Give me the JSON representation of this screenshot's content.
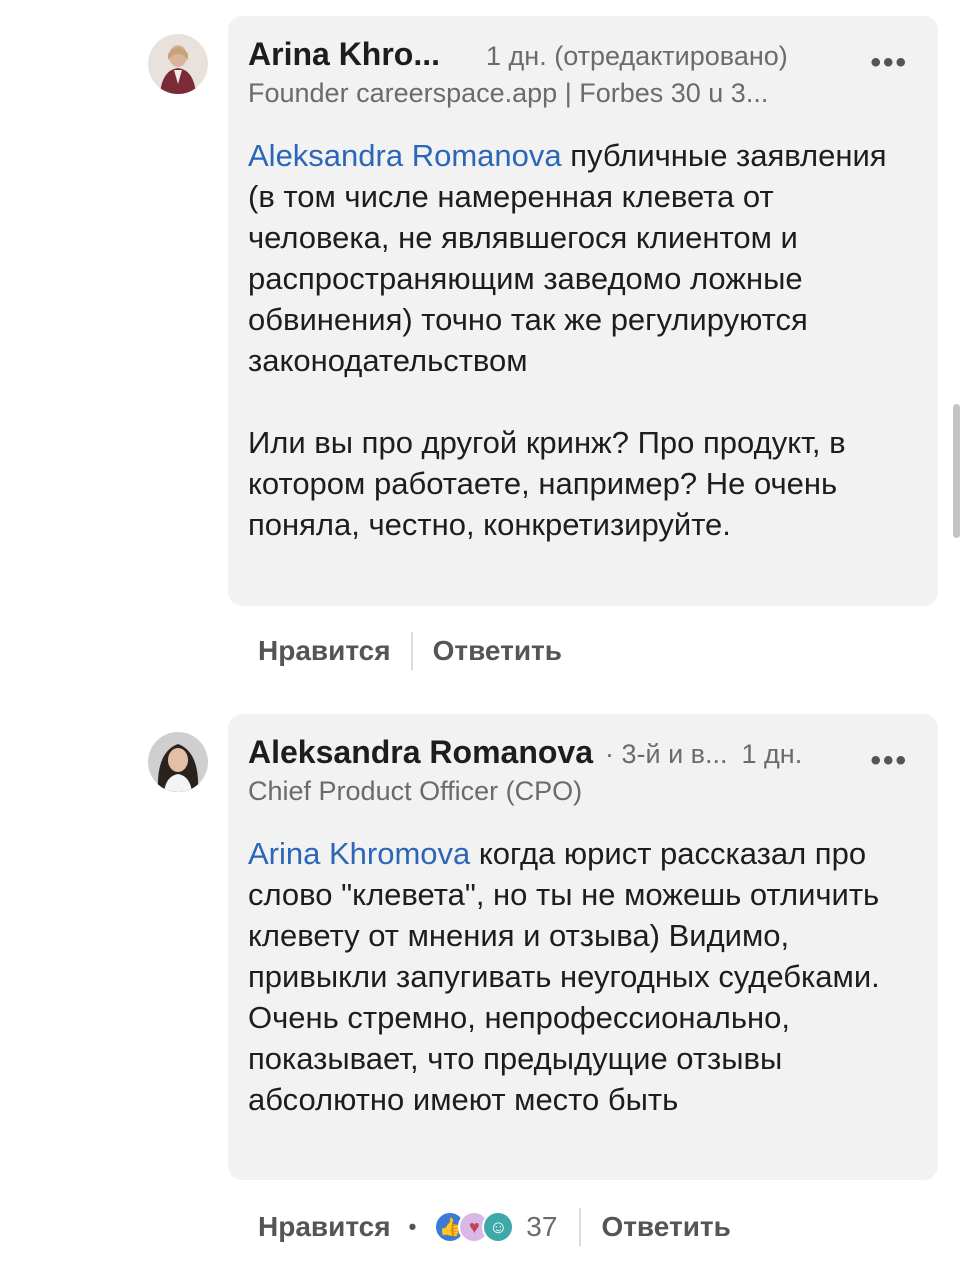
{
  "comments": [
    {
      "author": "Arina Khro...",
      "meta": "1 дн. (отредактировано)",
      "subtitle": "Founder careerspace.app | Forbes 30 u 3...",
      "mention": "Aleksandra Romanova",
      "text_after_mention": " публичные заявления (в том числе намеренная клевета от человека, не являвшегося клиентом и распространяющим заведомо ложные обвинения) точно так же регулируются законодательством",
      "paragraph2": "Или вы про другой кринж? Про продукт, в котором работаете, например? Не очень поняла, честно, конкретизируйте.",
      "like_label": "Нравится",
      "reply_label": "Ответить"
    },
    {
      "author": "Aleksandra Romanova",
      "degree": "· 3-й и в...",
      "meta": "1 дн.",
      "subtitle": "Chief Product Officer (CPO)",
      "mention": "Arina Khromova",
      "text_after_mention": " когда юрист рассказал про слово \"клевета\", но ты не можешь отличить клевету от мнения и отзыва) Видимо, привыкли запугивать неугодных судебками. Очень стремно, непрофессионально, показывает, что предыдущие отзывы абсолютно имеют место быть",
      "like_label": "Нравится",
      "reactions_count": "37",
      "reply_label": "Ответить"
    }
  ],
  "icons": {
    "more": "more-horizontal-icon",
    "reactions": [
      "like-icon",
      "love-icon",
      "funny-icon"
    ]
  },
  "colors": {
    "mention": "#2b66b8",
    "bubble": "#f2f2f2",
    "like_reaction": "#3b7bd8"
  }
}
